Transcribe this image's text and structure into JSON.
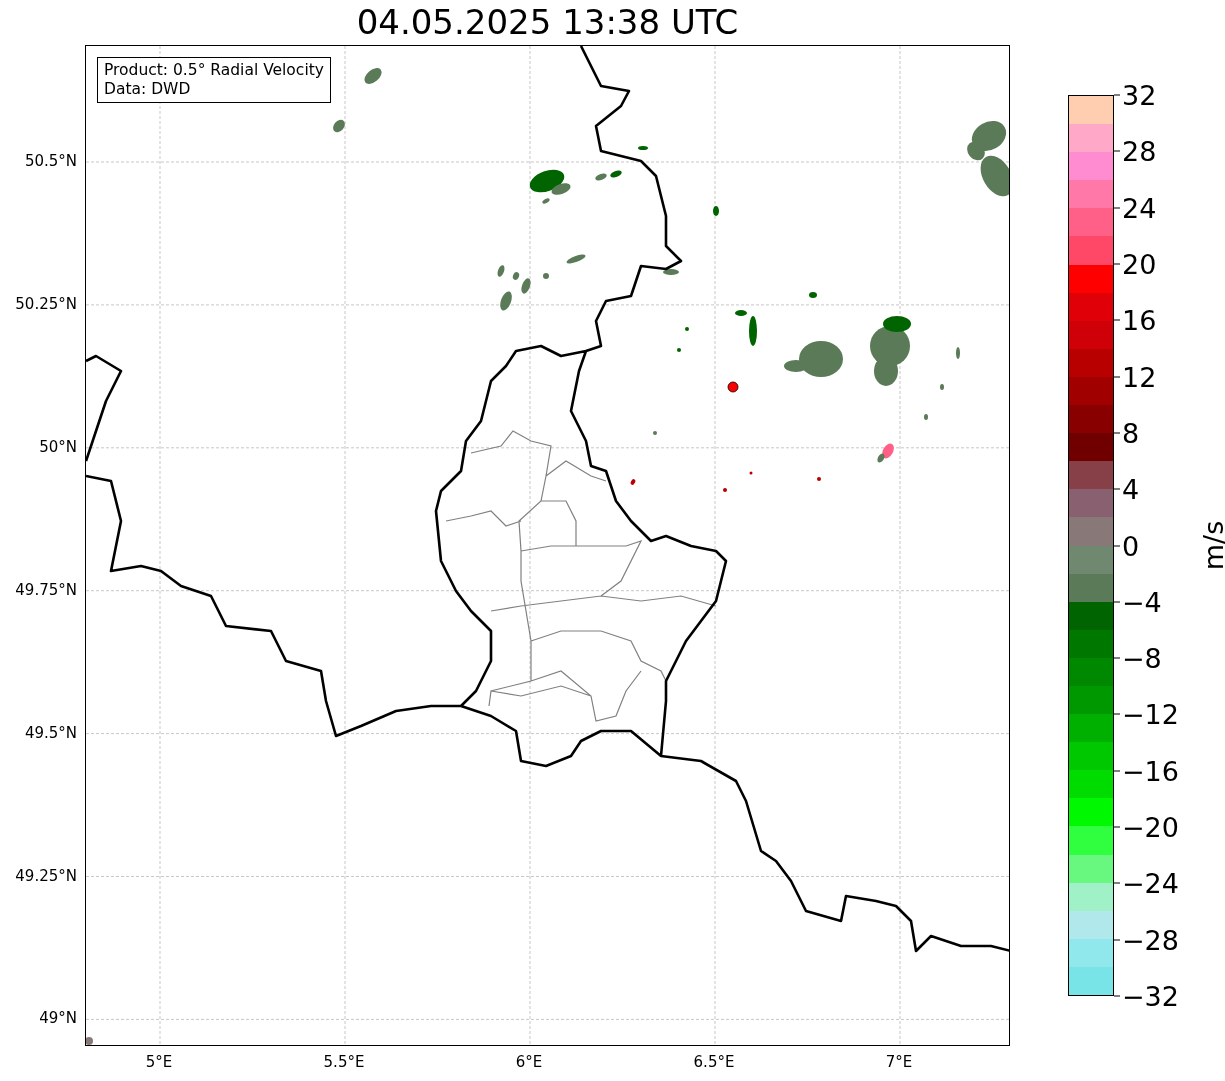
{
  "title": "04.05.2025 13:38 UTC",
  "map": {
    "info_box": [
      "Product: 0.5° Radial Velocity",
      "Data: DWD"
    ],
    "x_ticks": [
      "5°E",
      "5.5°E",
      "6°E",
      "6.5°E",
      "7°E"
    ],
    "y_ticks": [
      "50.5°N",
      "50.25°N",
      "50°N",
      "49.75°N",
      "49.5°N",
      "49.25°N",
      "49°N"
    ]
  },
  "colorbar": {
    "label": "m/s",
    "ticks": [
      "32",
      "28",
      "24",
      "20",
      "16",
      "12",
      "8",
      "4",
      "0",
      "−4",
      "−8",
      "−12",
      "−16",
      "−20",
      "−24",
      "−28",
      "−32"
    ],
    "bands": [
      {
        "color": "#ffcdb0"
      },
      {
        "color": "#ffa8c8"
      },
      {
        "color": "#ff8cd0"
      },
      {
        "color": "#ff78a8"
      },
      {
        "color": "#ff6088"
      },
      {
        "color": "#ff4868"
      },
      {
        "color": "#ff0000"
      },
      {
        "color": "#e00008"
      },
      {
        "color": "#d00008"
      },
      {
        "color": "#b80000"
      },
      {
        "color": "#a00000"
      },
      {
        "color": "#880000"
      },
      {
        "color": "#700000"
      },
      {
        "color": "#884048"
      },
      {
        "color": "#886070"
      },
      {
        "color": "#887878"
      },
      {
        "color": "#708870"
      },
      {
        "color": "#5a7a58"
      },
      {
        "color": "#006400"
      },
      {
        "color": "#007800"
      },
      {
        "color": "#008800"
      },
      {
        "color": "#009800"
      },
      {
        "color": "#00b000"
      },
      {
        "color": "#00c800"
      },
      {
        "color": "#00dc00"
      },
      {
        "color": "#00f800"
      },
      {
        "color": "#30ff40"
      },
      {
        "color": "#68f880"
      },
      {
        "color": "#a0f0c8"
      },
      {
        "color": "#b0e8ec"
      },
      {
        "color": "#90e8ec"
      },
      {
        "color": "#78e4e8"
      }
    ]
  }
}
